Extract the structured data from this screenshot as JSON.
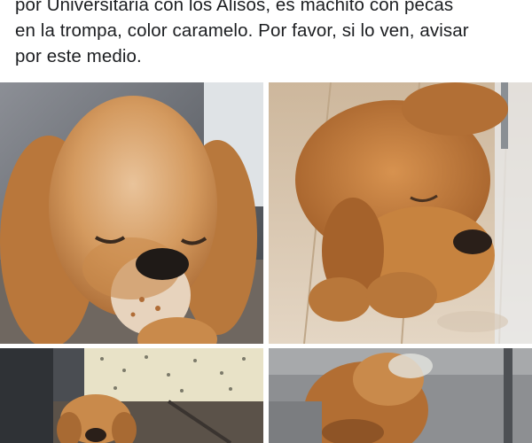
{
  "post": {
    "text_lines": [
      "por Universitaria con los Alisos, es machito con pecas",
      "en la trompa, color caramelo. Por favor, si lo ven, avisar",
      "por este medio."
    ]
  },
  "photos": [
    {
      "name": "dog-closeup-photo",
      "icon": "dog-photo"
    },
    {
      "name": "dog-lying-floor-photo",
      "icon": "dog-photo"
    },
    {
      "name": "dog-under-table-photo",
      "icon": "dog-photo"
    },
    {
      "name": "dog-blurred-photo",
      "icon": "dog-photo"
    }
  ],
  "colors": {
    "fur": "#c98a4b",
    "fur_dark": "#9a5a26",
    "floor": "#c9b59a",
    "text": "#1c1e21"
  }
}
